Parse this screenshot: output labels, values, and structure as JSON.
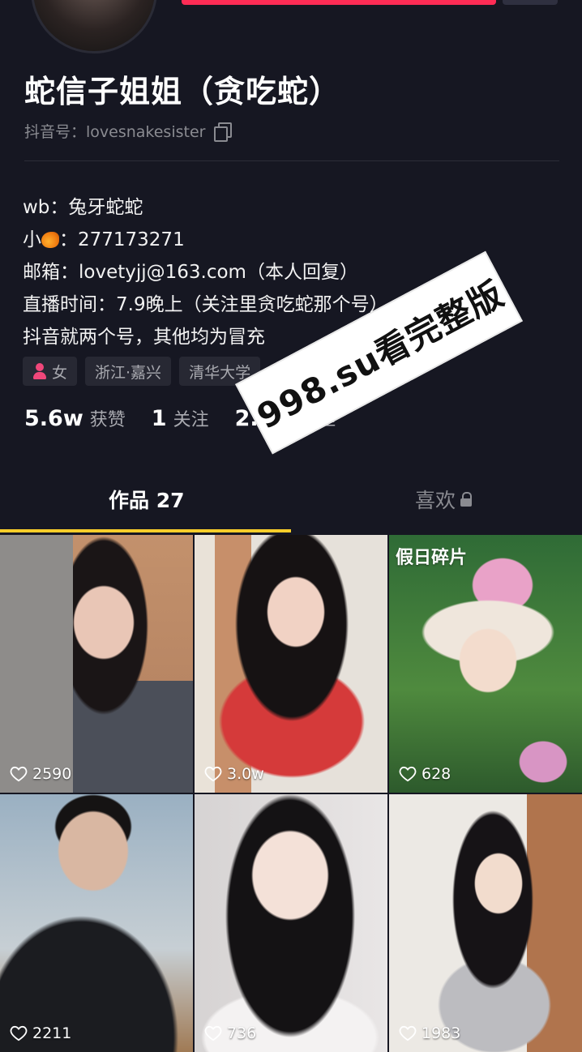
{
  "profile": {
    "nickname": "蛇信子姐姐（贪吃蛇）",
    "douyin_id": "抖音号：lovesnakesister",
    "bio_lines": [
      "wb：兔牙蛇蛇",
      "小",
      "邮箱：lovetyjj@163.com（本人回复）",
      "直播时间：7.9晚上（关注里贪吃蛇那个号）",
      "抖音就两个号，其他均为冒充"
    ],
    "qq_suffix": "：277173271",
    "tags": [
      "女",
      "浙江·嘉兴",
      "清华大学"
    ]
  },
  "stats": [
    {
      "value": "5.6w",
      "label": "获赞"
    },
    {
      "value": "1",
      "label": "关注"
    },
    {
      "value": "2.5w",
      "label": "粉丝"
    }
  ],
  "tabs": {
    "works": "作品 27",
    "likes": "喜欢"
  },
  "videos": [
    {
      "likes": "2590"
    },
    {
      "likes": "3.0w"
    },
    {
      "likes": "628",
      "cover_title": "假日碎片"
    },
    {
      "likes": "2211"
    },
    {
      "likes": "736"
    },
    {
      "likes": "1983"
    }
  ],
  "watermark": "998.su看完整版",
  "colors": {
    "background": "#161722",
    "accent_red": "#fe2c55",
    "tab_indicator": "#facd2a"
  }
}
